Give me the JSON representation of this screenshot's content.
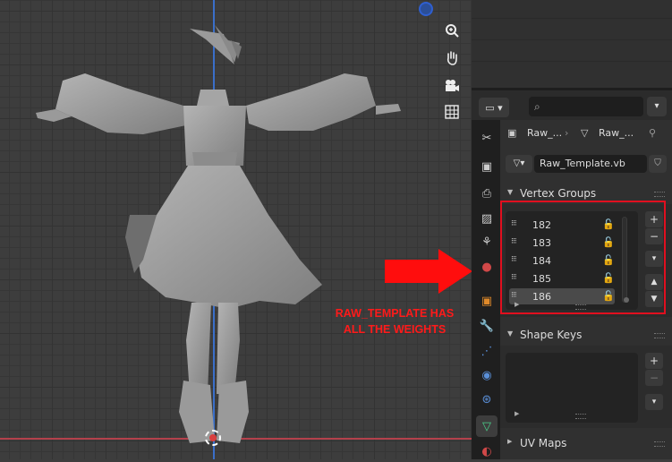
{
  "annotation": {
    "line1": "RAW_TEMPLATE HAS",
    "line2": "ALL THE WEIGHTS"
  },
  "properties": {
    "search": {
      "placeholder": ""
    },
    "context": {
      "object_name": "Raw_...",
      "mesh_name": "Raw_..."
    },
    "mesh_datablock": {
      "name": "Raw_Template.vb"
    },
    "vertex_groups": {
      "title": "Vertex Groups",
      "items": [
        {
          "name": "182"
        },
        {
          "name": "183"
        },
        {
          "name": "184"
        },
        {
          "name": "185"
        },
        {
          "name": "186",
          "selected": true
        }
      ],
      "add": "+",
      "remove": "−"
    },
    "shape_keys": {
      "title": "Shape Keys",
      "add": "+",
      "remove": "−"
    },
    "uv_maps": {
      "title": "UV Maps"
    }
  },
  "colors": {
    "highlight": "#e10f1f",
    "accent_axis_x": "#b4414c",
    "accent_axis_z": "#3a6fc9"
  },
  "icons": [
    "zoom-icon",
    "hand-icon",
    "camera-icon",
    "grid-icon",
    "wrench-icon",
    "mesh-data-icon"
  ]
}
